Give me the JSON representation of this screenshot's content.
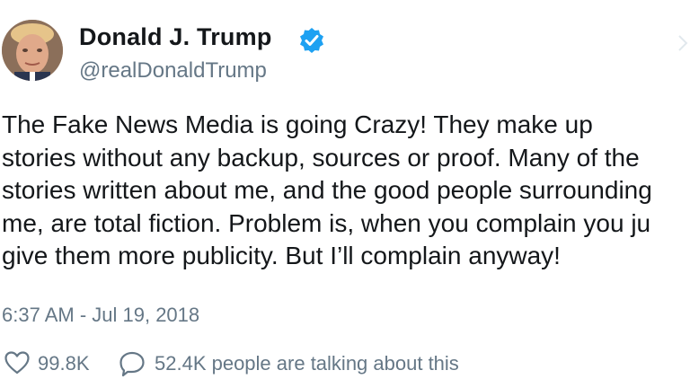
{
  "user": {
    "display_name": "Donald J. Trump",
    "handle": "@realDonaldTrump",
    "verified": true,
    "avatar_icon": "profile-photo"
  },
  "tweet": {
    "lines": [
      "The Fake News Media is going Crazy! They make up",
      "stories without any backup, sources or proof. Many of the",
      "stories written about me, and the good people surrounding",
      "me, are total fiction. Problem is, when you complain you ju",
      "give them more publicity. But I’ll complain anyway!"
    ],
    "timestamp": "6:37 AM - Jul 19, 2018"
  },
  "actions": {
    "like_count": "99.8K",
    "talking_text": "52.4K people are talking about this",
    "like_icon": "heart-outline-icon",
    "talk_icon": "speech-bubble-icon"
  },
  "colors": {
    "text": "#14171a",
    "secondary": "#657786",
    "verified_blue": "#1da1f2"
  }
}
